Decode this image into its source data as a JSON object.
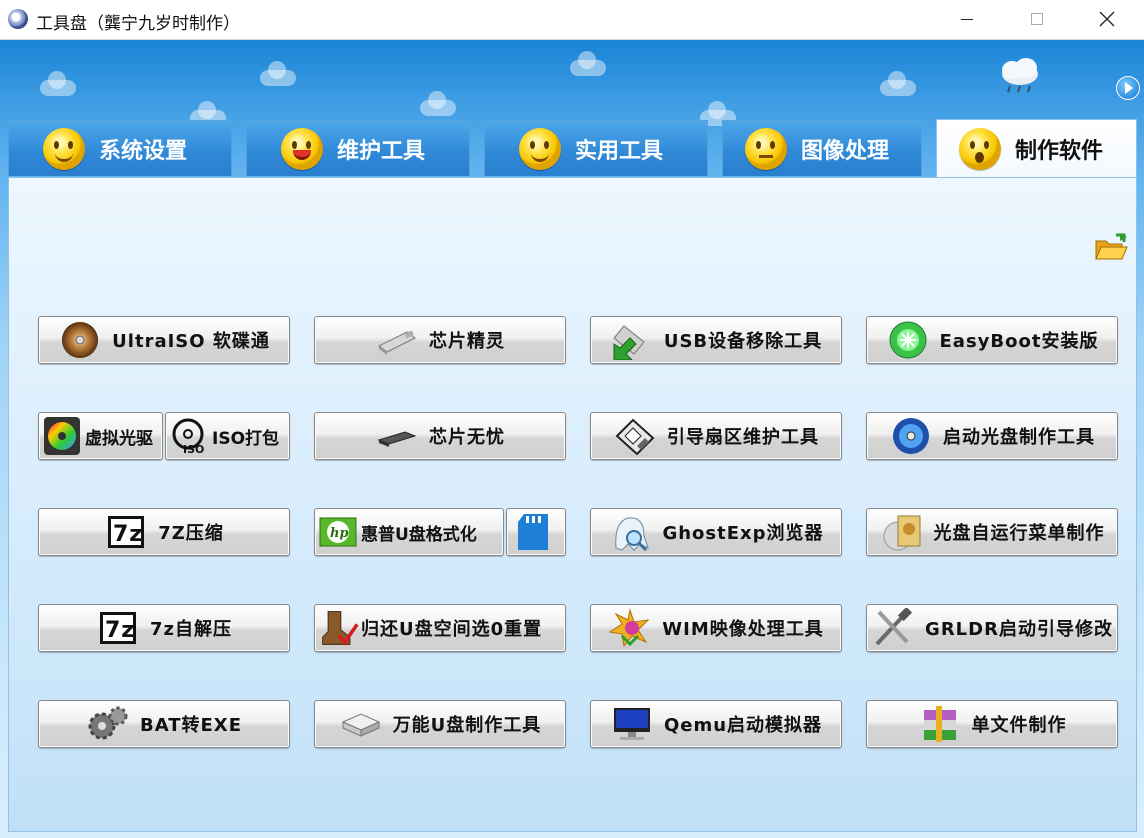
{
  "window": {
    "title": "工具盘（龔宁九岁时制作）",
    "controls": [
      "minimize",
      "maximize",
      "close"
    ]
  },
  "header": {
    "weather_icon": "cloud-rain-icon",
    "play_icon": "play-icon"
  },
  "tabs": [
    {
      "label": "系统设置",
      "icon": "smiley-icon",
      "active": false
    },
    {
      "label": "维护工具",
      "icon": "smiley-tongue-icon",
      "active": false
    },
    {
      "label": "实用工具",
      "icon": "smiley-icon",
      "active": false
    },
    {
      "label": "图像处理",
      "icon": "smiley-meh-icon",
      "active": false
    },
    {
      "label": "制作软件",
      "icon": "smiley-surprised-icon",
      "active": true
    }
  ],
  "panel": {
    "open_folder_icon": "open-folder-icon",
    "buttons": [
      {
        "label": "UltraISO 软碟通",
        "icon": "disc-icon"
      },
      {
        "label": "芯片精灵",
        "icon": "usb-drive-icon"
      },
      {
        "label": "USB设备移除工具",
        "icon": "usb-remove-icon"
      },
      {
        "label": "EasyBoot安装版",
        "icon": "easyboot-icon"
      },
      {
        "label": "虚拟光驱",
        "icon": "virtual-drive-icon"
      },
      {
        "label": "ISO打包",
        "icon": "iso-icon"
      },
      {
        "label": "芯片无忧",
        "icon": "chip-icon"
      },
      {
        "label": "引导扇区维护工具",
        "icon": "floppy-icon"
      },
      {
        "label": "启动光盘制作工具",
        "icon": "boot-disc-icon"
      },
      {
        "label": "7Z压缩",
        "icon": "7z-icon"
      },
      {
        "label": "惠普U盘格式化",
        "icon": "hp-icon"
      },
      {
        "label": "",
        "icon": "sd-card-icon"
      },
      {
        "label": "GhostExp浏览器",
        "icon": "ghost-icon"
      },
      {
        "label": "光盘自运行菜单制作",
        "icon": "autorun-icon"
      },
      {
        "label": "7z自解压",
        "icon": "7z-sfx-icon"
      },
      {
        "label": "归还U盘空间选0重置",
        "icon": "boot-check-icon"
      },
      {
        "label": "WIM映像处理工具",
        "icon": "wim-icon"
      },
      {
        "label": "GRLDR启动引导修改",
        "icon": "tools-icon"
      },
      {
        "label": "BAT转EXE",
        "icon": "gears-icon"
      },
      {
        "label": "万能U盘制作工具",
        "icon": "usb-box-icon"
      },
      {
        "label": "Qemu启动模拟器",
        "icon": "monitor-icon"
      },
      {
        "label": "单文件制作",
        "icon": "winrar-icon"
      }
    ]
  }
}
